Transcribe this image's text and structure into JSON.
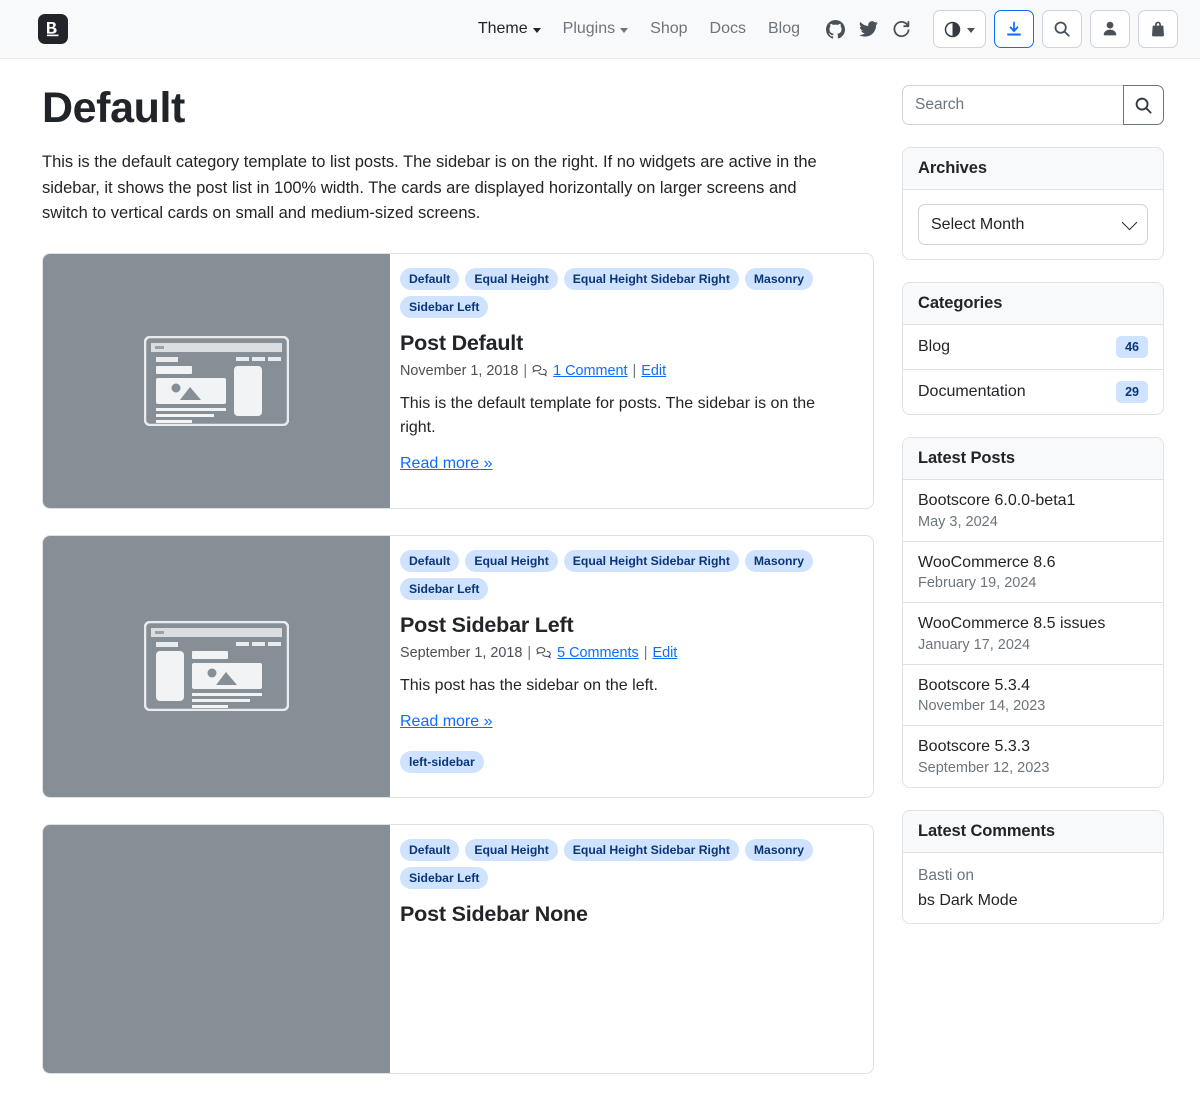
{
  "navbar": {
    "brand_icon": "bootscore-logo-icon",
    "links": [
      {
        "label": "Theme",
        "has_caret": true,
        "active": true
      },
      {
        "label": "Plugins",
        "has_caret": true,
        "active": false
      },
      {
        "label": "Shop",
        "has_caret": false,
        "active": false
      },
      {
        "label": "Docs",
        "has_caret": false,
        "active": false
      },
      {
        "label": "Blog",
        "has_caret": false,
        "active": false
      }
    ],
    "social_icons": [
      "github-icon",
      "twitter-icon",
      "rotate-icon"
    ],
    "buttons": [
      {
        "name": "theme-toggle-button",
        "icon": "half-circle-icon",
        "caret": true,
        "accent": false
      },
      {
        "name": "download-button",
        "icon": "download-icon",
        "caret": false,
        "accent": true
      },
      {
        "name": "search-button",
        "icon": "search-icon",
        "caret": false,
        "accent": false
      },
      {
        "name": "account-button",
        "icon": "person-icon",
        "caret": false,
        "accent": false
      },
      {
        "name": "cart-button",
        "icon": "bag-icon",
        "caret": false,
        "accent": false
      }
    ]
  },
  "page": {
    "title": "Default",
    "intro": "This is the default category template to list posts. The sidebar is on the right. If no widgets are active in the sidebar, it shows the post list in 100% width. The cards are displayed horizontally on larger screens and switch to vertical cards on small and medium-sized screens."
  },
  "posts": [
    {
      "badges": [
        "Default",
        "Equal Height",
        "Equal Height Sidebar Right",
        "Masonry",
        "Sidebar Left"
      ],
      "title": "Post Default",
      "date": "November 1, 2018",
      "comments": "1 Comment",
      "edit": "Edit",
      "excerpt": "This is the default template for posts. The sidebar is on the right.",
      "read_more": "Read more »",
      "thumb_layout": "sidebar-right",
      "tags": []
    },
    {
      "badges": [
        "Default",
        "Equal Height",
        "Equal Height Sidebar Right",
        "Masonry",
        "Sidebar Left"
      ],
      "title": "Post Sidebar Left",
      "date": "September 1, 2018",
      "comments": "5 Comments",
      "edit": "Edit",
      "excerpt": "This post has the sidebar on the left.",
      "read_more": "Read more »",
      "thumb_layout": "sidebar-left",
      "tags": [
        "left-sidebar"
      ]
    },
    {
      "badges": [
        "Default",
        "Equal Height",
        "Equal Height Sidebar Right",
        "Masonry",
        "Sidebar Left"
      ],
      "title": "Post Sidebar None",
      "date": "",
      "comments": "",
      "edit": "",
      "excerpt": "",
      "read_more": "",
      "thumb_layout": "sidebar-right",
      "tags": []
    }
  ],
  "sidebar": {
    "search": {
      "placeholder": "Search",
      "value": "",
      "button_icon": "search-icon"
    },
    "archives": {
      "header": "Archives",
      "select_value": "Select Month"
    },
    "categories": {
      "header": "Categories",
      "items": [
        {
          "label": "Blog",
          "count": "46"
        },
        {
          "label": "Documentation",
          "count": "29"
        }
      ]
    },
    "latest_posts": {
      "header": "Latest Posts",
      "items": [
        {
          "title": "Bootscore 6.0.0-beta1",
          "date": "May 3, 2024"
        },
        {
          "title": "WooCommerce 8.6",
          "date": "February 19, 2024"
        },
        {
          "title": "WooCommerce 8.5 issues",
          "date": "January 17, 2024"
        },
        {
          "title": "Bootscore 5.3.4",
          "date": "November 14, 2023"
        },
        {
          "title": "Bootscore 5.3.3",
          "date": "September 12, 2023"
        }
      ]
    },
    "latest_comments": {
      "header": "Latest Comments",
      "items": [
        {
          "author": "Basti on",
          "post": "bs Dark Mode"
        }
      ]
    }
  },
  "colors": {
    "accent": "#0d6efd",
    "badge_bg": "#cfe2ff",
    "badge_text": "#0a3678",
    "thumb_bg": "#868e96",
    "navbar_bg": "#f8f9fa"
  }
}
